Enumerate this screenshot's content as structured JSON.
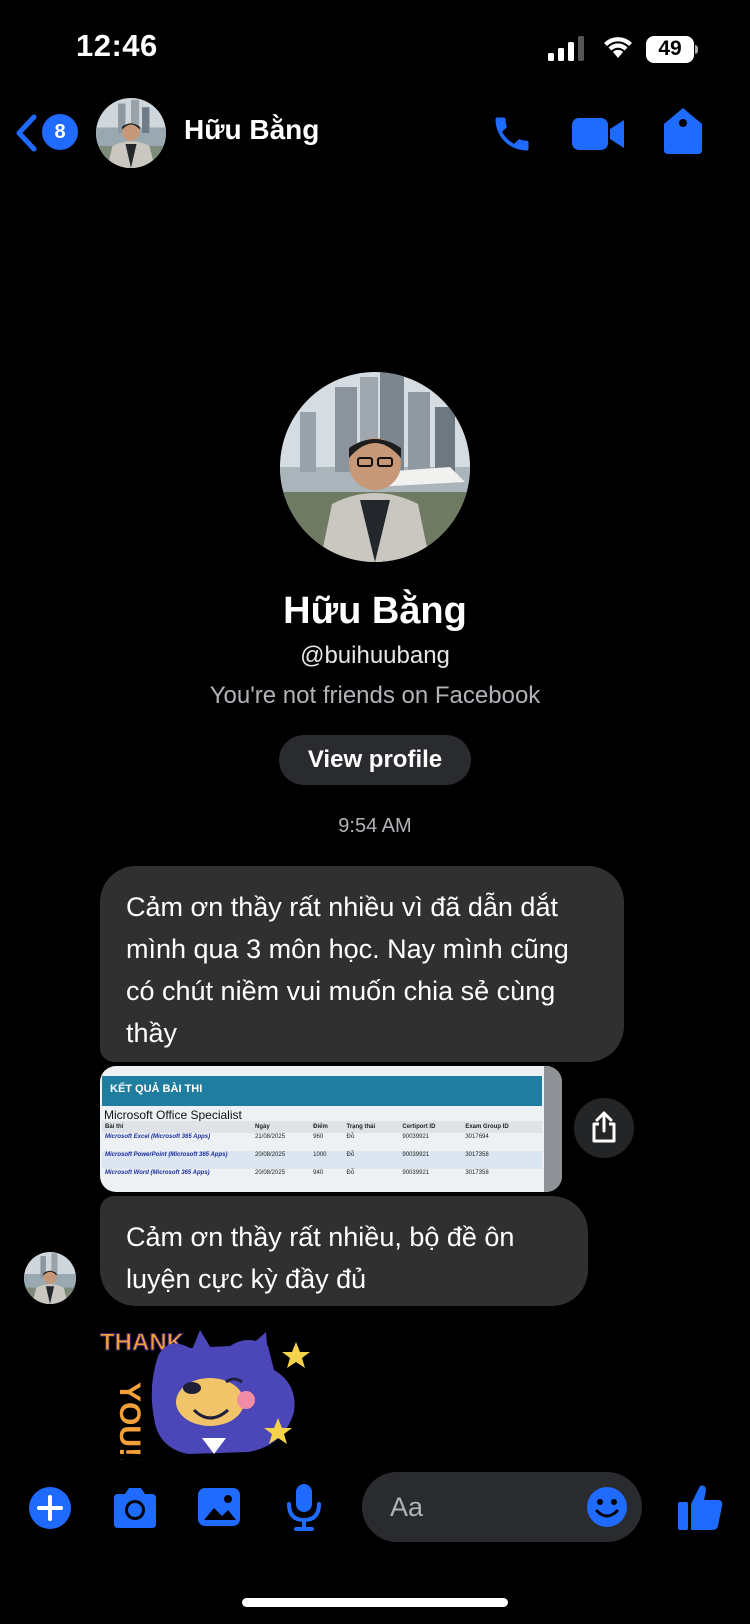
{
  "status_bar": {
    "time": "12:46",
    "battery": "49"
  },
  "header": {
    "back_count": "8",
    "name": "Hữu Bằng"
  },
  "profile": {
    "name": "Hữu Bằng",
    "handle": "@buihuubang",
    "relationship": "You're not friends on Facebook",
    "view_profile_label": "View profile"
  },
  "conversation": {
    "timestamp": "9:54 AM",
    "messages": [
      {
        "text": "Cảm ơn thầy rất nhiều vì đã dẫn dắt mình qua 3 môn học. Nay mình cũng có chút niềm vui muốn chia sẻ cùng thầy"
      },
      {
        "text": "Cảm ơn thầy rất nhiều, bộ đề ôn luyện cực kỳ đầy đủ"
      }
    ],
    "attachment": {
      "title": "KẾT QUẢ BÀI THI",
      "subtitle": "Microsoft Office Specialist",
      "columns": [
        "Bài thi",
        "Ngày",
        "Điểm",
        "Trạng thái",
        "Certiport ID",
        "Exam Group ID"
      ],
      "rows": [
        [
          "Microsoft Excel (Microsoft 365 Apps)",
          "21/08/2025",
          "960",
          "Đỗ",
          "90039921",
          "3017694"
        ],
        [
          "Microsoft PowerPoint (Microsoft 365 Apps)",
          "20/08/2025",
          "1000",
          "Đỗ",
          "90039921",
          "3017358"
        ],
        [
          "Microsoft Word (Microsoft 365 Apps)",
          "20/08/2025",
          "940",
          "Đỗ",
          "90039921",
          "3017358"
        ]
      ]
    },
    "sticker_text": "THANK YOU!!"
  },
  "composer": {
    "placeholder": "Aa"
  },
  "colors": {
    "accent": "#1f6bff",
    "bubble": "#303030",
    "background": "#000000"
  }
}
